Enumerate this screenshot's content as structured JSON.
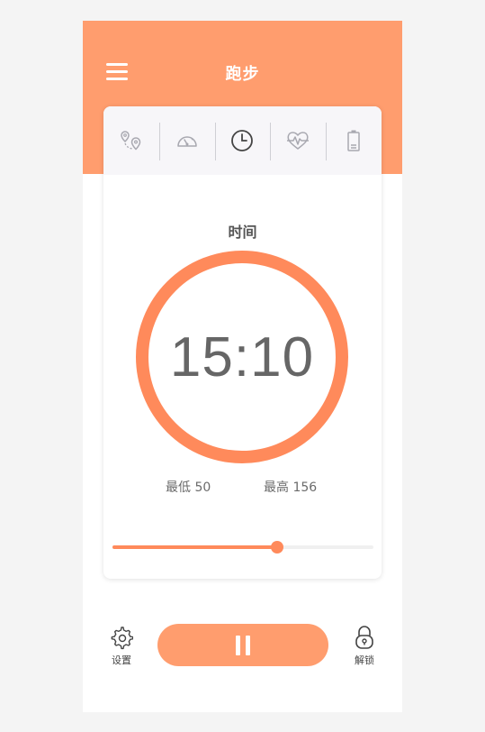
{
  "header": {
    "title": "跑步"
  },
  "tabs": [
    {
      "icon": "route-pin-icon",
      "active": false
    },
    {
      "icon": "speedometer-icon",
      "active": false
    },
    {
      "icon": "clock-icon",
      "active": true
    },
    {
      "icon": "heart-pulse-icon",
      "active": false
    },
    {
      "icon": "battery-icon",
      "active": false
    }
  ],
  "main": {
    "label": "时间",
    "time": "15:10",
    "low_label": "最低 50",
    "high_label": "最高 156",
    "progress": 0.63
  },
  "bottom": {
    "settings_label": "设置",
    "unlock_label": "解锁"
  },
  "colors": {
    "accent": "#ff9d6e",
    "ring": "#ff8a5b",
    "background": "#f4f4f4"
  }
}
